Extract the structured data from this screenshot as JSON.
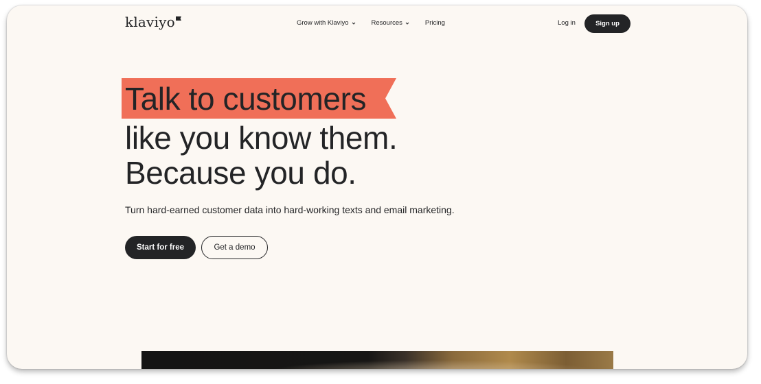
{
  "nav": {
    "logo": "klaviyo",
    "links": [
      {
        "label": "Grow with Klaviyo",
        "has_dropdown": true
      },
      {
        "label": "Resources",
        "has_dropdown": true
      },
      {
        "label": "Pricing",
        "has_dropdown": false
      }
    ],
    "login": "Log in",
    "signup": "Sign up"
  },
  "hero": {
    "headline_line1": "Talk to customers",
    "headline_line2": "like you know them.",
    "headline_line3": "Because you do.",
    "subheadline": "Turn hard-earned customer data into hard-working texts and email marketing.",
    "cta_primary": "Start for free",
    "cta_secondary": "Get a demo"
  },
  "colors": {
    "background": "#fcf8f3",
    "text": "#232426",
    "ribbon": "#f06f58",
    "button_dark": "#232426"
  },
  "icons": [
    "klaviyo-flag-icon",
    "chevron-down-icon"
  ]
}
